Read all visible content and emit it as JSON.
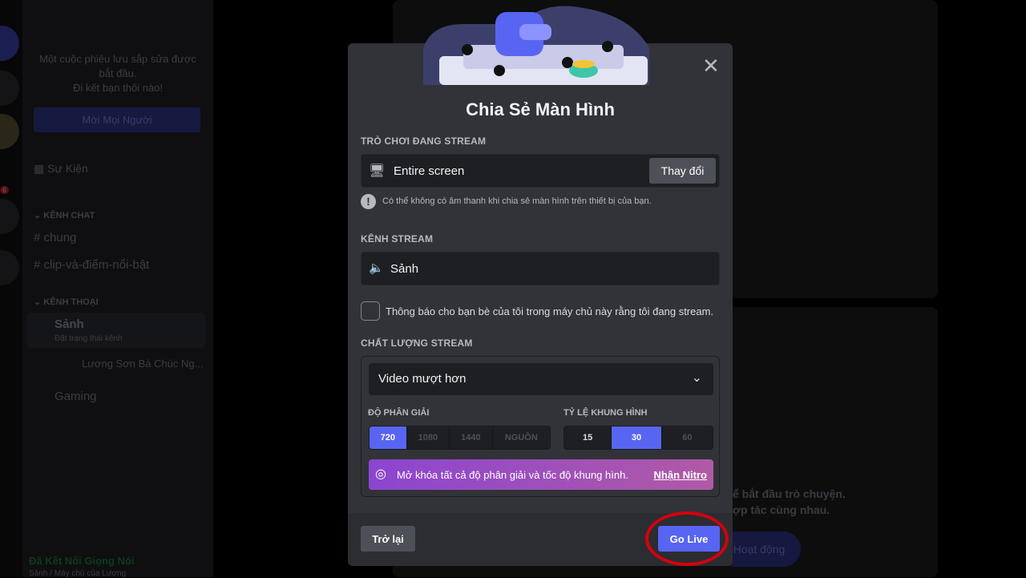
{
  "sidebar": {
    "invite_text_1": "Một cuộc phiêu lưu sắp sửa được",
    "invite_text_2": "bắt đầu.",
    "invite_text_3": "Đi kết bạn thôi nào!",
    "invite_button": "Mời Mọi Người",
    "events": "Sự Kiện",
    "text_category": "KÊNH CHAT",
    "text_channels": [
      "chung",
      "clip-và-điểm-nổi-bật"
    ],
    "voice_category": "KÊNH THOẠI",
    "voice_channel": "Sảnh",
    "voice_status": "Đặt trạng thái kênh",
    "voice_user": "Lương Sơn Bá Chúc Ng...",
    "voice_channel_2": "Gaming",
    "connection_status": "Đã Kết Nối Giọng Nói",
    "connection_location": "Sảnh / Máy chủ của Lương",
    "server_badge": "6"
  },
  "main": {
    "line1": "ể bắt đầu trò chuyện.",
    "line2": "ợp tác cùng nhau.",
    "activity_button": "Hoạt động"
  },
  "modal": {
    "title": "Chia Sẻ Màn Hình",
    "game_label": "TRÒ CHƠI ĐANG STREAM",
    "source": "Entire screen",
    "change_button": "Thay đổi",
    "warning": "Có thể không có âm thanh khi chia sẻ màn hình trên thiết bị của bạn.",
    "channel_label": "KÊNH STREAM",
    "channel": "Sảnh",
    "notify_text": "Thông báo cho bạn bè của tôi trong máy chủ này rằng tôi đang stream.",
    "notify_checked": false,
    "quality_label": "CHẤT LƯỢNG STREAM",
    "quality_value": "Video mượt hơn",
    "resolution_label": "ĐỘ PHÂN GIẢI",
    "resolutions": [
      "720",
      "1080",
      "1440",
      "NGUỒN"
    ],
    "resolution_selected": "720",
    "framerate_label": "TỶ LỆ KHUNG HÌNH",
    "framerates": [
      "15",
      "30",
      "60"
    ],
    "framerate_selected": "30",
    "nitro_text": "Mở khóa tất cả độ phân giải và tốc độ khung hình.",
    "nitro_link": "Nhận Nitro",
    "back_button": "Trở lại",
    "go_live_button": "Go Live"
  },
  "colors": {
    "accent": "#5865f2",
    "highlight_ring": "#d4000f",
    "connected": "#23a55a"
  }
}
